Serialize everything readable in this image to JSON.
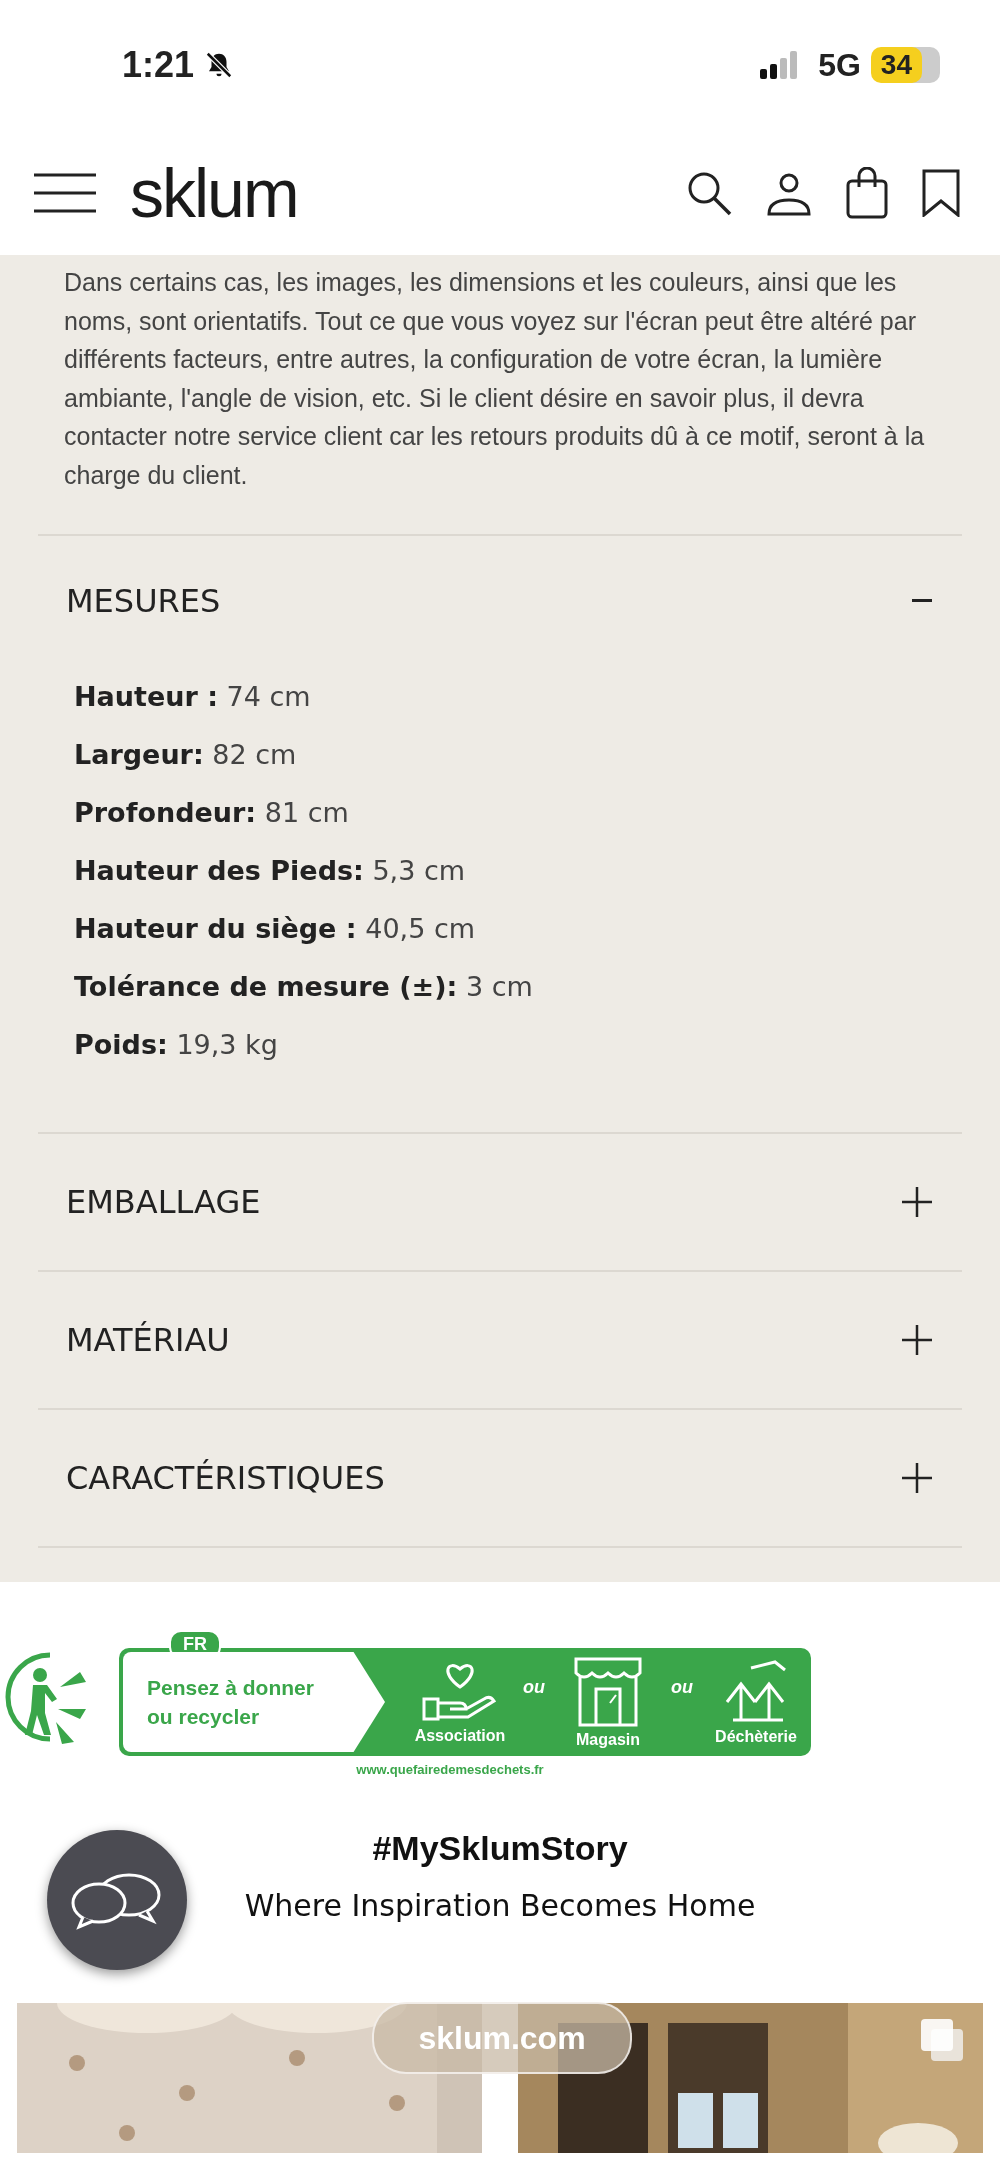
{
  "status_bar": {
    "time": "1:21",
    "network": "5G",
    "battery": "34"
  },
  "header": {
    "logo": "sklum"
  },
  "disclaimer": "Dans certains cas, les images, les dimensions et les couleurs, ainsi que les noms, sont orientatifs. Tout ce que vous voyez sur l'écran peut être altéré par différents facteurs, entre autres, la configuration de votre écran, la lumière ambiante, l'angle de vision, etc. Si le client désire en savoir plus, il devra contacter notre service client car les retours produits dû à ce motif, seront à la charge du client.",
  "sections": [
    {
      "title": "MESURES",
      "expanded": true,
      "items": [
        "**Hauteur :** 74 cm",
        "**Largeur:** 82 cm",
        "**Profondeur:** 81 cm",
        "**Hauteur des Pieds:** 5,3 cm",
        "**Hauteur du siège :** 40,5 cm",
        "**Tolérance de mesure (±):** 3 cm",
        "**Poids:** 19,3 kg"
      ]
    },
    {
      "title": "EMBALLAGE",
      "expanded": false
    },
    {
      "title": "MATÉRIAU",
      "expanded": false
    },
    {
      "title": "CARACTÉRISTIQUES",
      "expanded": false
    }
  ],
  "recycle_banner": {
    "country": "FR",
    "message": "Pensez à donner ou recycler",
    "options": [
      {
        "label": "Association",
        "kind": "hand"
      },
      {
        "label": "Magasin",
        "kind": "shop"
      },
      {
        "label": "Déchèterie",
        "kind": "bin"
      }
    ],
    "separators": [
      "ou",
      "ou"
    ],
    "url": "www.quefairedemesdechets.fr"
  },
  "story": {
    "title": "#MySklumStory",
    "subtitle": "Where Inspiration Becomes Home"
  },
  "gallery": [
    {
      "kind": "picture",
      "multiple": false
    },
    {
      "kind": "picture",
      "multiple": true
    }
  ],
  "address_bar": {
    "url": "sklum.com"
  }
}
